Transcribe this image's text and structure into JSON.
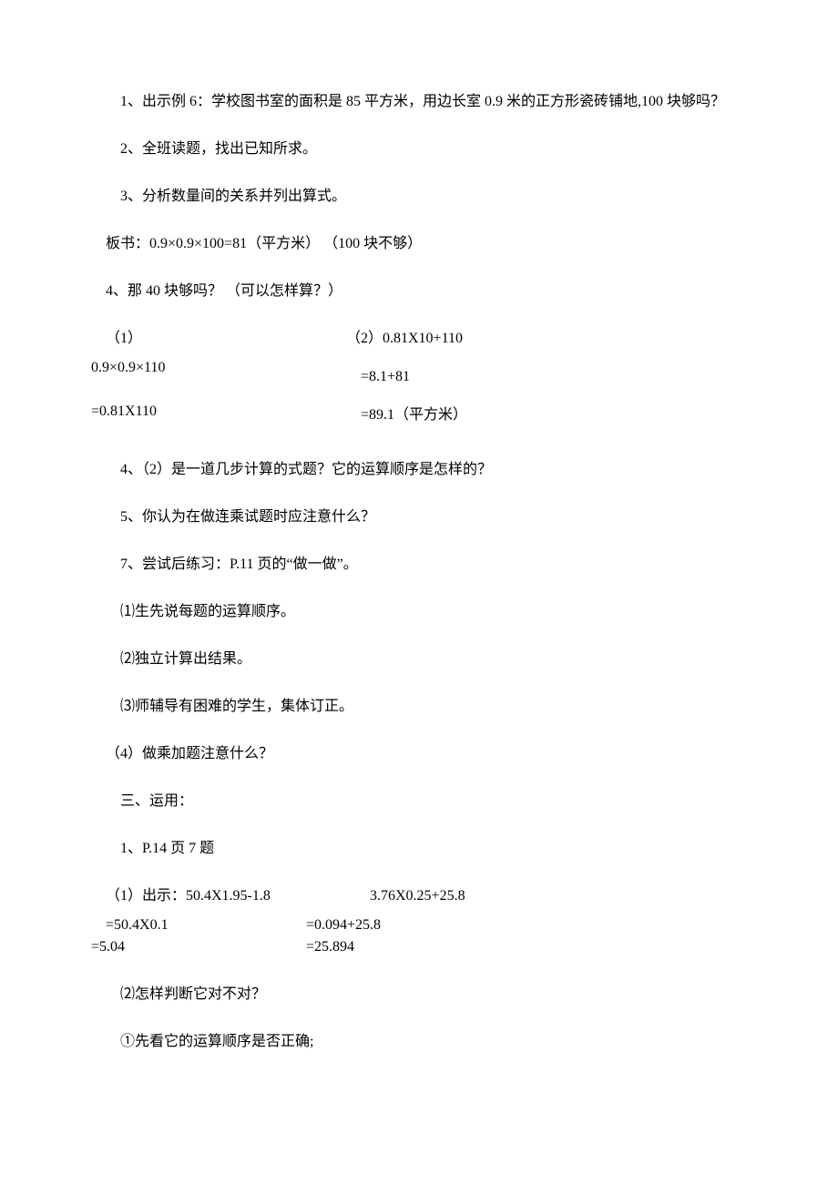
{
  "p1": "1、出示例 6：学校图书室的面积是 85 平方米，用边长室 0.9 米的正方形瓷砖铺地,100 块够吗？",
  "p2": "2、全班读题，找出已知所求。",
  "p3": "3、分析数量间的关系并列出算式。",
  "p4": "板书：0.9×0.9×100=81（平方米）        （100 块不够）",
  "p5": "4、那 40 块够吗？    （可以怎样算？）",
  "calc_left_1": "（1）",
  "calc_left_2": "0.9×0.9×110",
  "calc_left_3": "=0.81X110",
  "calc_right_1": "（2）0.81X10+110",
  "calc_right_2": "=8.1+81",
  "calc_right_3": "=89.1（平方米）",
  "p6": "4、（2）是一道几步计算的式题？它的运算顺序是怎样的？",
  "p7": "5、你认为在做连乘试题时应注意什么？",
  "p8": "7、尝试后练习：P.11 页的“做一做”。",
  "p9": "⑴生先说每题的运算顺序。",
  "p10": "⑵独立计算出结果。",
  "p11": "⑶师辅导有困难的学生，集体订正。",
  "p12": "（4）做乘加题注意什么？",
  "p13": "三、运用：",
  "p14": "1、P.14 页 7 题",
  "expr_a": "（1）出示：50.4X1.95-1.8",
  "expr_b": "3.76X0.25+25.8",
  "calc_a_1": "=50.4X0.1",
  "calc_a_2": "=5.04",
  "calc_b_1": "=0.094+25.8",
  "calc_b_2": "=25.894",
  "p15": "⑵怎样判断它对不对？",
  "p16": "①先看它的运算顺序是否正确;"
}
